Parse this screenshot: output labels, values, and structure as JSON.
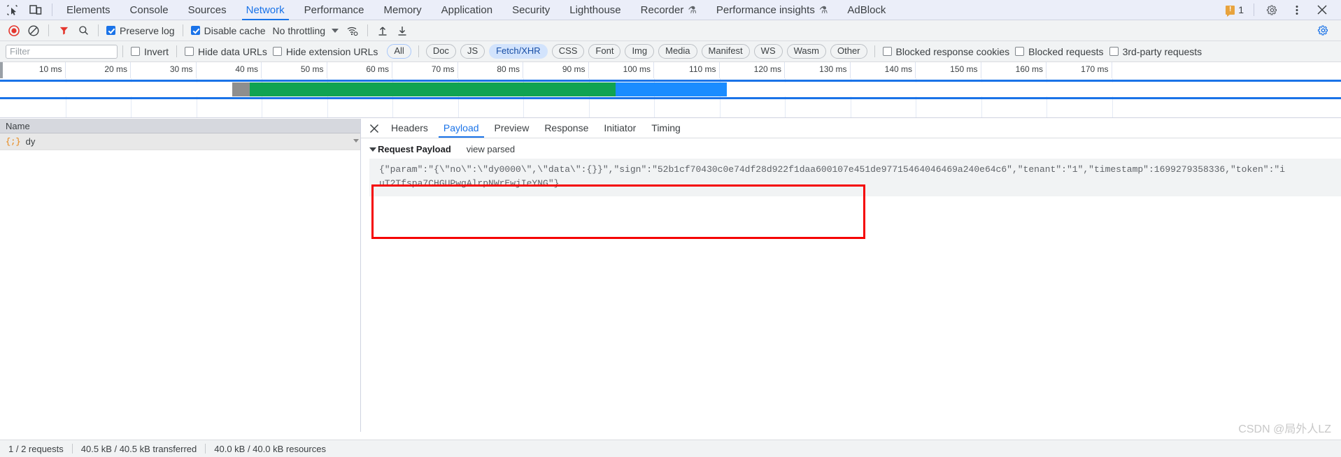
{
  "tabbar": {
    "icons": [
      {
        "name": "inspect-element-icon",
        "glyph": "inspect"
      },
      {
        "name": "device-toolbar-icon",
        "glyph": "device"
      }
    ],
    "tabs": [
      {
        "label": "Elements",
        "active": false,
        "flask": false
      },
      {
        "label": "Console",
        "active": false,
        "flask": false
      },
      {
        "label": "Sources",
        "active": false,
        "flask": false
      },
      {
        "label": "Network",
        "active": true,
        "flask": false
      },
      {
        "label": "Performance",
        "active": false,
        "flask": false
      },
      {
        "label": "Memory",
        "active": false,
        "flask": false
      },
      {
        "label": "Application",
        "active": false,
        "flask": false
      },
      {
        "label": "Security",
        "active": false,
        "flask": false
      },
      {
        "label": "Lighthouse",
        "active": false,
        "flask": false
      },
      {
        "label": "Recorder",
        "active": false,
        "flask": true
      },
      {
        "label": "Performance insights",
        "active": false,
        "flask": true
      },
      {
        "label": "AdBlock",
        "active": false,
        "flask": false
      }
    ],
    "warning_count": "1",
    "right_icons": [
      "settings-gear-icon",
      "more-options-icon",
      "close-devtools-icon"
    ],
    "warning_color": "#e8a33d",
    "accent_color": "#1a73e8"
  },
  "toolbar": {
    "record_label": "record-button",
    "clear_label": "clear-button",
    "filter_label": "filter-button",
    "search_label": "search-button",
    "preserve_log": {
      "label": "Preserve log",
      "checked": true
    },
    "disable_cache": {
      "label": "Disable cache",
      "checked": true
    },
    "throttling": {
      "value": "No throttling"
    },
    "wifi_label": "network-conditions-icon",
    "import_label": "import-har-button",
    "export_label": "export-har-button",
    "settings_label": "network-settings-icon"
  },
  "filterbar": {
    "filter_placeholder": "Filter",
    "filter_value": "",
    "invert": {
      "label": "Invert",
      "checked": false
    },
    "hide_data_urls": {
      "label": "Hide data URLs",
      "checked": false
    },
    "hide_extension_urls": {
      "label": "Hide extension URLs",
      "checked": false
    },
    "types": [
      {
        "label": "All",
        "selected": false
      },
      {
        "label": "Doc",
        "selected": false
      },
      {
        "label": "JS",
        "selected": false
      },
      {
        "label": "Fetch/XHR",
        "selected": true
      },
      {
        "label": "CSS",
        "selected": false
      },
      {
        "label": "Font",
        "selected": false
      },
      {
        "label": "Img",
        "selected": false
      },
      {
        "label": "Media",
        "selected": false
      },
      {
        "label": "Manifest",
        "selected": false
      },
      {
        "label": "WS",
        "selected": false
      },
      {
        "label": "Wasm",
        "selected": false
      },
      {
        "label": "Other",
        "selected": false
      }
    ],
    "blocked_response_cookies": {
      "label": "Blocked response cookies",
      "checked": false
    },
    "blocked_requests": {
      "label": "Blocked requests",
      "checked": false
    },
    "third_party_requests": {
      "label": "3rd-party requests",
      "checked": false
    }
  },
  "overview": {
    "ticks": [
      "10 ms",
      "20 ms",
      "30 ms",
      "40 ms",
      "50 ms",
      "60 ms",
      "70 ms",
      "80 ms",
      "90 ms",
      "100 ms",
      "110 ms",
      "120 ms",
      "130 ms",
      "140 ms",
      "150 ms",
      "160 ms",
      "170 ms"
    ],
    "tick_spacing_px": 93.5,
    "waterfall": [
      {
        "phase": "stalled",
        "color": "#ffffff",
        "start_pct": 0,
        "end_pct": 17.3
      },
      {
        "phase": "dns-connect",
        "color": "#8e8e8e",
        "start_pct": 17.3,
        "end_pct": 18.6
      },
      {
        "phase": "request-sent",
        "color": "#10a352",
        "start_pct": 18.6,
        "end_pct": 45.9
      },
      {
        "phase": "content-download",
        "color": "#1a8cff",
        "start_pct": 45.9,
        "end_pct": 54.2
      }
    ],
    "band_border_color": "#1a73e8"
  },
  "requests": {
    "column_header": "Name",
    "rows": [
      {
        "name": "dy",
        "icon": "json-icon",
        "selected": true
      }
    ]
  },
  "detail": {
    "tabs": [
      {
        "label": "Headers",
        "active": false
      },
      {
        "label": "Payload",
        "active": true
      },
      {
        "label": "Preview",
        "active": false
      },
      {
        "label": "Response",
        "active": false
      },
      {
        "label": "Initiator",
        "active": false
      },
      {
        "label": "Timing",
        "active": false
      }
    ],
    "close_icon": "close-panel-icon",
    "section_title": "Request Payload",
    "view_parsed": "view parsed",
    "payload_lines": [
      "{\"param\":\"{\\\"no\\\":\\\"dy0000\\\",\\\"data\\\":{}}\",\"sign\":\"52b1cf70430c0e74df28d922f1daa600107e451de97715464046469a240e64c6\",\"tenant\":\"1\",\"timestamp\":1699279358336,\"token\":\"i",
      "uT2Tfspa7CHGUPwgAlrpNWrEwjIeYNG\"}"
    ],
    "highlight_color": "#f50505"
  },
  "statusbar": {
    "items": [
      "1 / 2 requests",
      "40.5 kB / 40.5 kB transferred",
      "40.0 kB / 40.0 kB resources"
    ]
  },
  "watermark": "CSDN @局外人LZ"
}
